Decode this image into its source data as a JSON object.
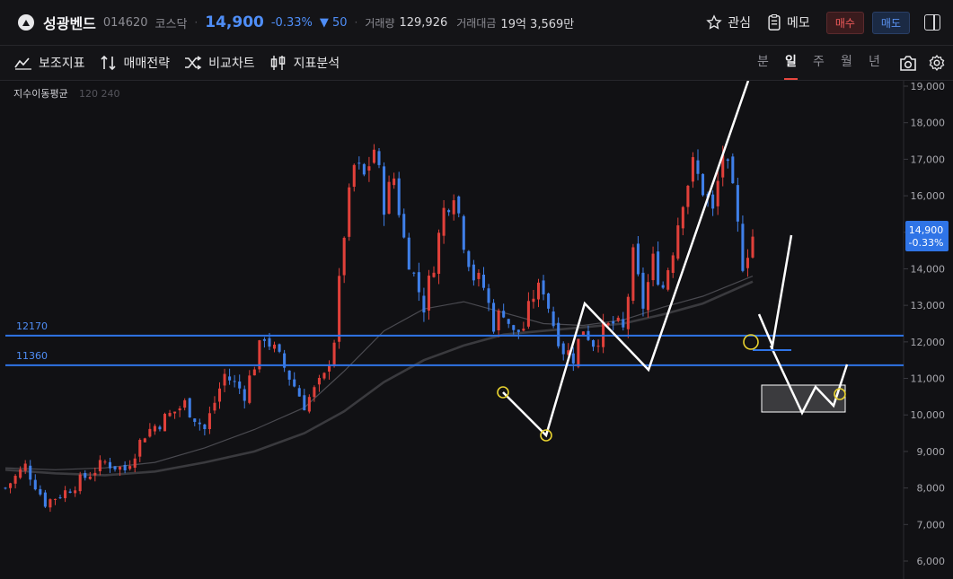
{
  "header": {
    "stock_name": "성광벤드",
    "stock_code": "014620",
    "market": "코스닥",
    "price": "14,900",
    "change_pct": "-0.33%",
    "change_abs": "▼ 50",
    "volume_label": "거래량",
    "volume": "129,926",
    "amount_label": "거래대금",
    "amount": "19억 3,569만",
    "watch_label": "관심",
    "memo_label": "메모",
    "buy_label": "매수",
    "sell_label": "매도"
  },
  "toolbar": {
    "indicator_label": "보조지표",
    "strategy_label": "매매전략",
    "compare_label": "비교차트",
    "pattern_label": "지표분석",
    "periods": [
      "분",
      "일",
      "주",
      "월",
      "년"
    ],
    "active_period": "일"
  },
  "colors": {
    "up": "#e0403a",
    "down": "#3f7fe8",
    "level_line": "#2f74e6",
    "drawing": "#ffffff",
    "marker": "#e8d230"
  },
  "chart_data": {
    "type": "candlestick",
    "indicator_title": "지수이동평균",
    "indicator_params": "120 240",
    "ylim": [
      6000,
      19000
    ],
    "y_ticks": [
      "6,000",
      "7,000",
      "8,000",
      "9,000",
      "10,000",
      "11,000",
      "12,000",
      "13,000",
      "14,000",
      "15,000",
      "16,000",
      "17,000",
      "18,000",
      "19,000"
    ],
    "last_price": "14,900",
    "last_change": "-0.33%",
    "price_path": [
      [
        0,
        8000
      ],
      [
        4,
        8600
      ],
      [
        8,
        7600
      ],
      [
        12,
        7900
      ],
      [
        16,
        8300
      ],
      [
        20,
        8700
      ],
      [
        24,
        8500
      ],
      [
        28,
        9500
      ],
      [
        32,
        9900
      ],
      [
        36,
        10300
      ],
      [
        40,
        9600
      ],
      [
        44,
        11100
      ],
      [
        48,
        10600
      ],
      [
        52,
        12200
      ],
      [
        56,
        11300
      ],
      [
        60,
        10300
      ],
      [
        64,
        11000
      ],
      [
        66,
        12100
      ],
      [
        68,
        15000
      ],
      [
        70,
        16800
      ],
      [
        72,
        16500
      ],
      [
        74,
        17300
      ],
      [
        76,
        15800
      ],
      [
        78,
        16500
      ],
      [
        80,
        14800
      ],
      [
        82,
        13800
      ],
      [
        84,
        13000
      ],
      [
        86,
        14200
      ],
      [
        88,
        15600
      ],
      [
        90,
        16200
      ],
      [
        92,
        14800
      ],
      [
        94,
        13800
      ],
      [
        96,
        13500
      ],
      [
        98,
        12500
      ],
      [
        100,
        12900
      ],
      [
        102,
        12200
      ],
      [
        104,
        12400
      ],
      [
        106,
        13300
      ],
      [
        108,
        13500
      ],
      [
        110,
        12500
      ],
      [
        112,
        11800
      ],
      [
        114,
        11600
      ],
      [
        116,
        12400
      ],
      [
        118,
        12000
      ],
      [
        120,
        12300
      ],
      [
        122,
        12500
      ],
      [
        124,
        12300
      ],
      [
        126,
        14300
      ],
      [
        128,
        13000
      ],
      [
        130,
        14200
      ],
      [
        132,
        13500
      ],
      [
        134,
        14600
      ],
      [
        136,
        16000
      ],
      [
        138,
        16800
      ],
      [
        140,
        16200
      ],
      [
        142,
        15500
      ],
      [
        144,
        17200
      ],
      [
        146,
        16000
      ],
      [
        148,
        14200
      ],
      [
        150,
        14900
      ]
    ],
    "ema_120": [
      [
        0,
        8550
      ],
      [
        10,
        8500
      ],
      [
        20,
        8550
      ],
      [
        30,
        8700
      ],
      [
        40,
        9100
      ],
      [
        50,
        9600
      ],
      [
        60,
        10200
      ],
      [
        68,
        11200
      ],
      [
        76,
        12300
      ],
      [
        84,
        12900
      ],
      [
        92,
        13100
      ],
      [
        100,
        12800
      ],
      [
        108,
        12500
      ],
      [
        116,
        12450
      ],
      [
        124,
        12600
      ],
      [
        132,
        12950
      ],
      [
        140,
        13250
      ],
      [
        150,
        13800
      ]
    ],
    "ema_240": [
      [
        0,
        8500
      ],
      [
        10,
        8400
      ],
      [
        20,
        8350
      ],
      [
        30,
        8450
      ],
      [
        40,
        8700
      ],
      [
        50,
        9000
      ],
      [
        60,
        9500
      ],
      [
        68,
        10100
      ],
      [
        76,
        10900
      ],
      [
        84,
        11500
      ],
      [
        92,
        11900
      ],
      [
        100,
        12200
      ],
      [
        108,
        12300
      ],
      [
        116,
        12400
      ],
      [
        124,
        12500
      ],
      [
        132,
        12750
      ],
      [
        140,
        13050
      ],
      [
        150,
        13650
      ]
    ],
    "levels": [
      {
        "label": "12170",
        "value": 12170
      },
      {
        "label": "11360",
        "value": 11360
      }
    ]
  }
}
